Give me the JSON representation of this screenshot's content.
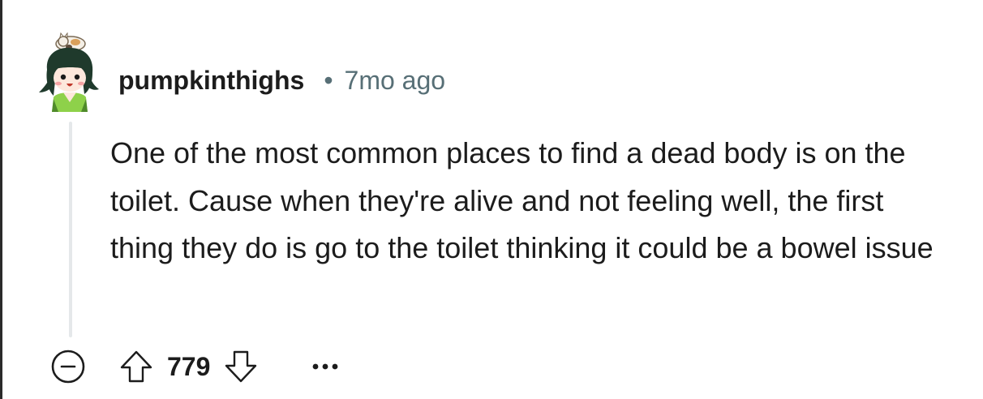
{
  "comment": {
    "username": "pumpkinthighs",
    "separator": "•",
    "timestamp": "7mo ago",
    "body": "One of the most common places to find a dead body is on the toilet. Cause when they're alive and not feeling well, the first thing they do is go to the toilet thinking it could be a bowel issue",
    "score": "779"
  },
  "icons": {
    "collapse": "minus-circle-icon",
    "upvote": "arrow-up-icon",
    "downvote": "arrow-down-icon",
    "more": "ellipsis-icon"
  },
  "colors": {
    "text": "#1c1c1c",
    "meta": "#576f76",
    "thread_line": "#e5e8ea"
  }
}
